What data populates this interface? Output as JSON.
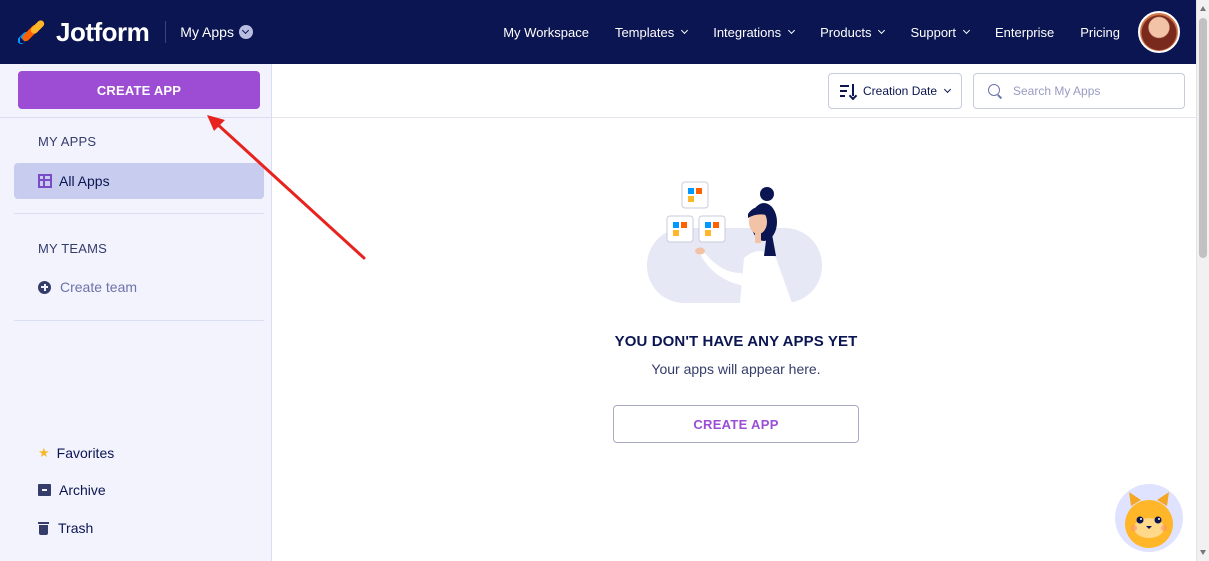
{
  "header": {
    "brand": "Jotform",
    "section_title": "My Apps",
    "nav": [
      {
        "label": "My Workspace",
        "has_caret": false
      },
      {
        "label": "Templates",
        "has_caret": true
      },
      {
        "label": "Integrations",
        "has_caret": true
      },
      {
        "label": "Products",
        "has_caret": true
      },
      {
        "label": "Support",
        "has_caret": true
      },
      {
        "label": "Enterprise",
        "has_caret": false
      },
      {
        "label": "Pricing",
        "has_caret": false
      }
    ]
  },
  "sidebar": {
    "create_button": "CREATE APP",
    "my_apps_heading": "MY APPS",
    "all_apps_label": "All Apps",
    "my_teams_heading": "MY TEAMS",
    "create_team_label": "Create team",
    "favorites_label": "Favorites",
    "archive_label": "Archive",
    "trash_label": "Trash"
  },
  "toolbar": {
    "sort_label": "Creation Date",
    "search_placeholder": "Search My Apps"
  },
  "main": {
    "empty_title": "YOU DON'T HAVE ANY APPS YET",
    "empty_subtitle": "Your apps will appear here.",
    "create_button": "CREATE APP"
  },
  "colors": {
    "navbar": "#0a1551",
    "accent_purple": "#9c4dd3",
    "sidebar_bg": "#f3f3fe",
    "active_item_bg": "#c8ccee",
    "annotation_arrow": "#e8231f"
  }
}
